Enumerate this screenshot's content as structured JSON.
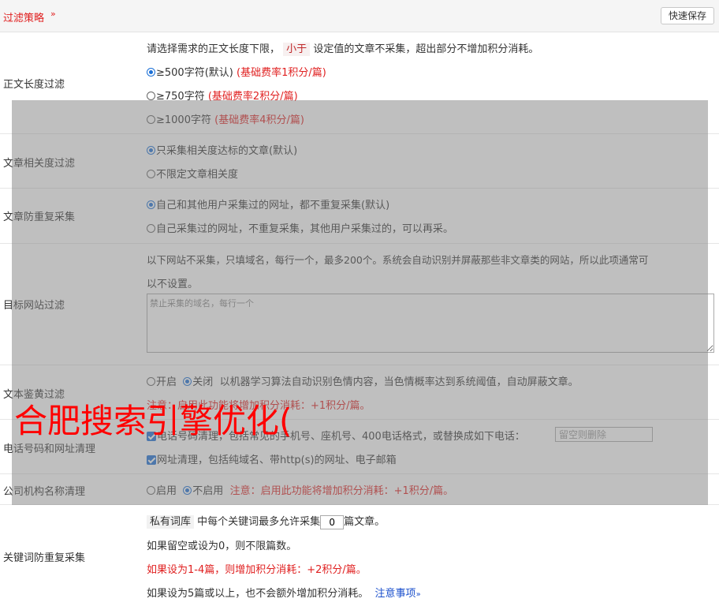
{
  "header": {
    "title": "过滤策略",
    "save_label": "快速保存"
  },
  "length_filter": {
    "label": "正文长度过滤",
    "desc_pre": "请选择需求的正文长度下限，",
    "desc_tag": "小于",
    "desc_post": "设定值的文章不采集，超出部分不增加积分消耗。",
    "options": [
      {
        "text": "≥500字符(默认)",
        "note": "(基础费率1积分/篇)",
        "selected": true
      },
      {
        "text": "≥750字符",
        "note": "(基础费率2积分/篇)",
        "selected": false
      },
      {
        "text": "≥1000字符",
        "note": "(基础费率4积分/篇)",
        "selected": false
      }
    ]
  },
  "relevance": {
    "label": "文章相关度过滤",
    "options": [
      {
        "text": "只采集相关度达标的文章(默认)",
        "selected": true
      },
      {
        "text": "不限定文章相关度",
        "selected": false
      }
    ]
  },
  "dedupe": {
    "label": "文章防重复采集",
    "options": [
      {
        "text": "自己和其他用户采集过的网址，都不重复采集(默认)",
        "selected": true
      },
      {
        "text": "自己采集过的网址，不重复采集，其他用户采集过的，可以再采。",
        "selected": false
      }
    ]
  },
  "site_filter": {
    "label": "目标网站过滤",
    "desc_line1": "以下网站不采集，只填域名，每行一个，最多200个。系统会自动识别并屏蔽那些非文章类的网站，所以此项通常可",
    "desc_line2": "以不设置。",
    "placeholder": "禁止采集的域名，每行一个"
  },
  "porn_filter": {
    "label": "文本鉴黄过滤",
    "on_label": "开启",
    "off_label": "关闭",
    "selected": "关闭",
    "desc": "以机器学习算法自动识别色情内容，当色情概率达到系统阈值，自动屏蔽文章。",
    "note": "注意：启用此功能将增加积分消耗：+1积分/篇。"
  },
  "contact_clean": {
    "label": "电话号码和网址清理",
    "phone_text": "电话号码清理，包括常见的手机号、座机号、400电话格式，或替换成如下电话：",
    "phone_checked": true,
    "phone_placeholder": "留空则删除",
    "url_text": "网址清理，包括纯域名、带http(s)的网址、电子邮箱",
    "url_checked": true
  },
  "org_clean": {
    "label": "公司机构名称清理",
    "on_label": "启用",
    "off_label": "不启用",
    "selected": "不启用",
    "note": "注意：启用此功能将增加积分消耗：+1积分/篇。"
  },
  "keyword_dedupe": {
    "label": "关键词防重复采集",
    "tag": "私有词库",
    "text_pre": "中每个关键词最多允许采集",
    "value": "0",
    "text_post": "篇文章。",
    "line2": "如果留空或设为0，则不限篇数。",
    "line3": "如果设为1-4篇，则增加积分消耗：+2积分/篇。",
    "line4": "如果设为5篇或以上，也不会额外增加积分消耗。",
    "help_link": "注意事项"
  },
  "watermark": {
    "text": "合肥搜索引擎优化("
  },
  "colors": {
    "accent": "#e02020",
    "link": "#1a4fcc",
    "radio": "#1a6fd6"
  }
}
